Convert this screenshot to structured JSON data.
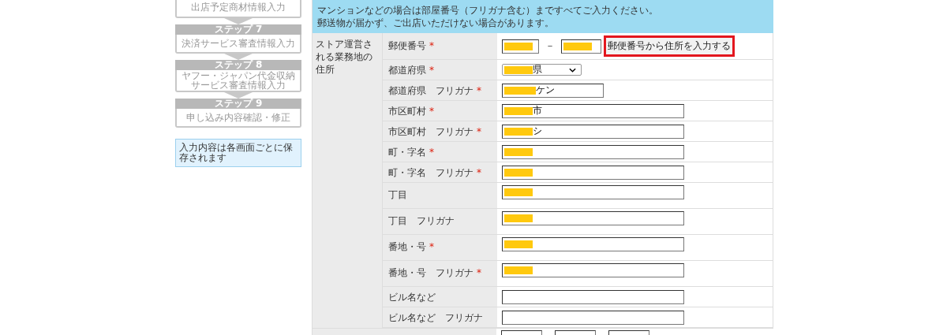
{
  "steps": [
    {
      "title": "出店予定商材情報入力"
    },
    {
      "header": "ステップ 7",
      "title": "決済サービス審査情報入力"
    },
    {
      "header": "ステップ 8",
      "title": "ヤフー・ジャパン代金収納サービス審査情報入力"
    },
    {
      "header": "ステップ 9",
      "title": "申し込み内容確認・修正"
    }
  ],
  "save_note": "入力内容は各画面ごとに保存されます",
  "notice": [
    "マンションなどの場合は部屋番号（フリガナ含む）まですべてご入力ください。",
    "郵送物が届かず、ご出店いただけない場合があります。"
  ],
  "section_label": "ストア運営される業務地の住所",
  "required_mark": "*",
  "rows": [
    {
      "kind": "postal",
      "label": "郵便番号",
      "required": true,
      "fields": [
        {
          "redacted": true
        },
        {
          "redacted": true
        }
      ],
      "separator": "－",
      "button": "郵便番号から住所を入力する"
    },
    {
      "kind": "select",
      "label": "都道府県",
      "required": true,
      "redacted": true,
      "value": "県"
    },
    {
      "kind": "short",
      "label": "都道府県　フリガナ",
      "required": true,
      "redacted": true,
      "value": "ケン"
    },
    {
      "kind": "text",
      "label": "市区町村",
      "required": true,
      "redacted": true,
      "value": "市"
    },
    {
      "kind": "text",
      "label": "市区町村　フリガナ",
      "required": true,
      "redacted": true,
      "value": "シ"
    },
    {
      "kind": "text",
      "label": "町・字名",
      "required": true,
      "redacted": true
    },
    {
      "kind": "text",
      "label": "町・字名　フリガナ",
      "required": true,
      "redacted": true
    },
    {
      "kind": "tall",
      "label": "丁目",
      "required": false,
      "redacted": true
    },
    {
      "kind": "tall",
      "label": "丁目　フリガナ",
      "required": false,
      "redacted": true
    },
    {
      "kind": "tall",
      "label": "番地・号",
      "required": true,
      "redacted": true
    },
    {
      "kind": "tall",
      "label": "番地・号　フリガナ",
      "required": true,
      "redacted": true
    },
    {
      "kind": "text",
      "label": "ビル名など",
      "required": false,
      "redacted": false
    },
    {
      "kind": "text",
      "label": "ビル名など　フリガナ",
      "required": false,
      "redacted": false
    }
  ],
  "next_row_fields": [
    {
      "redacted": false
    },
    {
      "redacted": false
    },
    {
      "redacted": false
    }
  ]
}
